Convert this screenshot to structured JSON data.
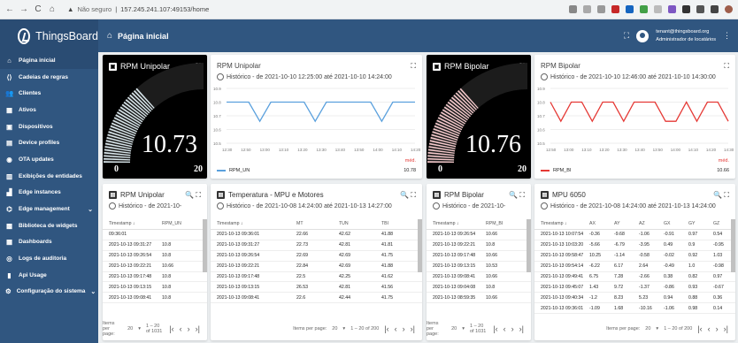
{
  "browser": {
    "url_warning": "Não seguro",
    "url": "157.245.241.107:49153/home",
    "nav": [
      "←",
      "→",
      "C",
      "⌂"
    ]
  },
  "app": {
    "name": "ThingsBoard",
    "page_title": "Página inicial",
    "user_email": "tenant@thingsboard.org",
    "user_role": "Administrador de locatários"
  },
  "sidebar": {
    "items": [
      {
        "label": "Página inicial",
        "icon": "home-icon",
        "glyph": "⌂",
        "active": true
      },
      {
        "label": "Cadeias de regras",
        "icon": "rule-chain-icon",
        "glyph": "⟨⟩"
      },
      {
        "label": "Clientes",
        "icon": "customers-icon",
        "glyph": "👥"
      },
      {
        "label": "Ativos",
        "icon": "assets-icon",
        "glyph": "▦"
      },
      {
        "label": "Dispositivos",
        "icon": "devices-icon",
        "glyph": "▣"
      },
      {
        "label": "Device profiles",
        "icon": "device-profiles-icon",
        "glyph": "▤"
      },
      {
        "label": "OTA updates",
        "icon": "ota-icon",
        "glyph": "◉"
      },
      {
        "label": "Exibições de entidades",
        "icon": "entity-views-icon",
        "glyph": "▥"
      },
      {
        "label": "Edge instances",
        "icon": "edge-icon",
        "glyph": "▟"
      },
      {
        "label": "Edge management",
        "icon": "edge-management-icon",
        "glyph": "⌬",
        "chevron": "⌄"
      },
      {
        "label": "Biblioteca de widgets",
        "icon": "widgets-icon",
        "glyph": "▩"
      },
      {
        "label": "Dashboards",
        "icon": "dashboards-icon",
        "glyph": "▦"
      },
      {
        "label": "Logs de auditoria",
        "icon": "audit-icon",
        "glyph": "◎"
      },
      {
        "label": "Api Usage",
        "icon": "api-usage-icon",
        "glyph": "▮"
      },
      {
        "label": "Configuração do sistema",
        "icon": "settings-icon",
        "glyph": "⚙",
        "chevron": "⌄"
      }
    ]
  },
  "gauges": [
    {
      "title": "RPM Unipolar",
      "value": "10.73",
      "value_num": 10.73,
      "min": "0",
      "max": "20",
      "color": "#d8e5ea"
    },
    {
      "title": "RPM Bipolar",
      "value": "10.76",
      "value_num": 10.76,
      "min": "0",
      "max": "20",
      "color": "#f2c7c9"
    }
  ],
  "line_charts": [
    {
      "title": "RPM Unipolar",
      "history": "Histórico - de 2021-10-10 12:25:00 até 2021-10-10 14:24:00",
      "series": "RPM_UN",
      "color": "#5aa0dd",
      "avg_label": "méd.",
      "avg_value": "10.78",
      "yticks": [
        "10.9",
        "10.8",
        "10.7",
        "10.6",
        "10.5"
      ],
      "xticks": [
        "12:30",
        "12:50",
        "13:00",
        "13:10",
        "13:20",
        "13:30",
        "13:40",
        "13:50",
        "14:00",
        "14:10",
        "14:20"
      ]
    },
    {
      "title": "RPM Bipolar",
      "history": "Histórico - de 2021-10-10 12:46:00 até 2021-10-10 14:30:00",
      "series": "RPM_BI",
      "color": "#e53935",
      "avg_label": "méd.",
      "avg_value": "10.66",
      "yticks": [
        "10.9",
        "10.8",
        "10.7",
        "10.6",
        "10.5"
      ],
      "xticks": [
        "12:50",
        "13:00",
        "13:10",
        "13:20",
        "13:30",
        "13:40",
        "13:50",
        "14:00",
        "14:10",
        "14:20",
        "14:30"
      ]
    }
  ],
  "tables": {
    "unipolar": {
      "title": "RPM Unipolar",
      "history": "Histórico - de 2021-10-",
      "cols": [
        "Timestamp ↓",
        "RPM_UN"
      ],
      "rows": [
        [
          "09:36:01",
          ""
        ],
        [
          "2021-10-13 09:31:27",
          "10.8"
        ],
        [
          "2021-10-13 09:26:54",
          "10.8"
        ],
        [
          "2021-10-13 09:22:21",
          "10.66"
        ],
        [
          "2021-10-13 09:17:48",
          "10.8"
        ],
        [
          "2021-10-13 09:13:15",
          "10.8"
        ],
        [
          "2021-10-13 09:08:41",
          "10.8"
        ]
      ],
      "pager": "1 – 20 of 1031",
      "items_label": "Items per page:",
      "per_page": "20"
    },
    "temperatura": {
      "title": "Temperatura - MPU e Motores",
      "history": "Histórico - de 2021-10-08 14:24:00 até 2021-10-13 14:27:00",
      "cols": [
        "Timestamp ↓",
        "MT",
        "TUN",
        "TBI"
      ],
      "rows": [
        [
          "2021-10-13 09:36:01",
          "22.66",
          "42.62",
          "41.88"
        ],
        [
          "2021-10-13 09:31:27",
          "22.73",
          "42.81",
          "41.81"
        ],
        [
          "2021-10-13 09:26:54",
          "22.69",
          "42.69",
          "41.75"
        ],
        [
          "2021-10-13 09:22:21",
          "22.84",
          "42.69",
          "41.88"
        ],
        [
          "2021-10-13 09:17:48",
          "22.5",
          "42.25",
          "41.62"
        ],
        [
          "2021-10-13 09:13:15",
          "26.53",
          "42.81",
          "41.56"
        ],
        [
          "2021-10-13 09:08:41",
          "22.6",
          "42.44",
          "41.75"
        ]
      ],
      "pager": "1 – 20 of 200",
      "items_label": "Items per page:",
      "per_page": "20"
    },
    "bipolar": {
      "title": "RPM Bipolar",
      "history": "Histórico - de 2021-10-",
      "cols": [
        "Timestamp ↓",
        "RPM_BI"
      ],
      "rows": [
        [
          "2021-10-13 09:26:54",
          "10.66"
        ],
        [
          "2021-10-13 09:22:21",
          "10.8"
        ],
        [
          "2021-10-13 09:17:48",
          "10.66"
        ],
        [
          "2021-10-13 09:13:15",
          "10.53"
        ],
        [
          "2021-10-13 09:08:41",
          "10.66"
        ],
        [
          "2021-10-13 09:04:08",
          "10.8"
        ],
        [
          "2021-10-13 08:59:35",
          "10.66"
        ]
      ],
      "pager": "1 – 20 of 1031",
      "items_label": "Items per page:",
      "per_page": "20"
    },
    "mpu": {
      "title": "MPU 6050",
      "history": "Histórico - de 2021-10-08 14:24:00 até 2021-10-13 14:24:00",
      "cols": [
        "Timestamp ↓",
        "AX",
        "AY",
        "AZ",
        "GX",
        "GY",
        "GZ"
      ],
      "rows": [
        [
          "2021-10-13 10:07:54",
          "-0.36",
          "-9.68",
          "-1.06",
          "-0.91",
          "0.97",
          "0.54"
        ],
        [
          "2021-10-13 10:03:20",
          "-5.66",
          "-6.79",
          "-3.95",
          "0.49",
          "0.9",
          "-0.95"
        ],
        [
          "2021-10-13 09:58:47",
          "10.25",
          "-1.14",
          "-0.58",
          "-0.02",
          "0.92",
          "1.03"
        ],
        [
          "2021-10-13 09:54:14",
          "-6.22",
          "6.17",
          "2.64",
          "-0.49",
          "1.0",
          "-0.98"
        ],
        [
          "2021-10-13 09:49:41",
          "6.75",
          "7.28",
          "-2.66",
          "0.38",
          "0.82",
          "0.97"
        ],
        [
          "2021-10-13 09:45:07",
          "1.43",
          "9.72",
          "-1.37",
          "-0.86",
          "0.93",
          "-0.67"
        ],
        [
          "2021-10-13 09:40:34",
          "-1.2",
          "8.23",
          "5.23",
          "0.94",
          "0.88",
          "0.36"
        ],
        [
          "2021-10-13 09:36:01",
          "-1.09",
          "1.68",
          "-10.16",
          "-1.06",
          "0.98",
          "0.14"
        ]
      ],
      "pager": "1 – 20 of 200",
      "items_label": "Items per page:",
      "per_page": "20"
    }
  }
}
